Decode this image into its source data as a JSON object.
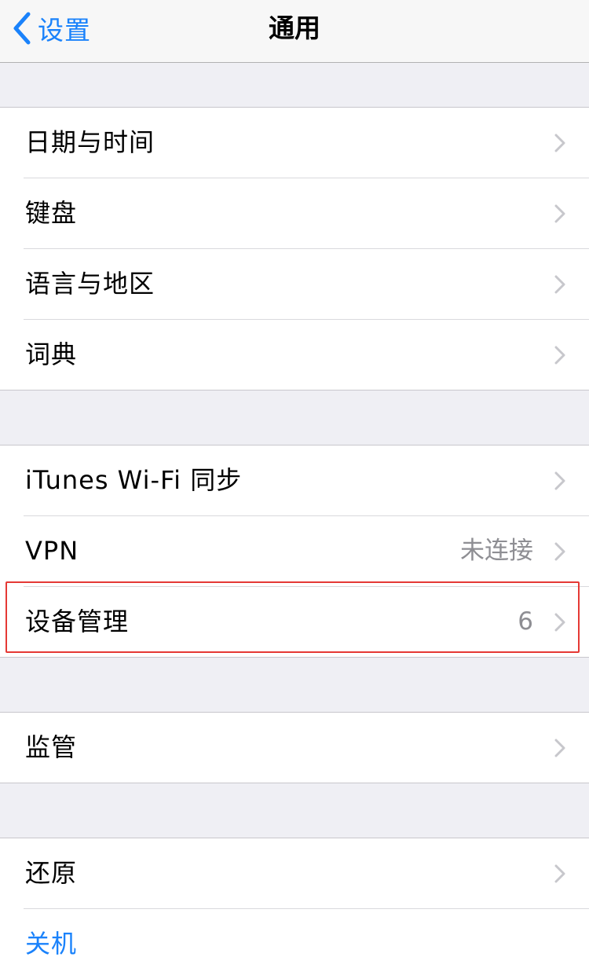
{
  "nav": {
    "back_label": "设置",
    "title": "通用"
  },
  "groups": [
    {
      "rows": [
        {
          "label": "日期与时间"
        },
        {
          "label": "键盘"
        },
        {
          "label": "语言与地区"
        },
        {
          "label": "词典"
        }
      ]
    },
    {
      "rows": [
        {
          "label": "iTunes Wi-Fi 同步"
        },
        {
          "label": "VPN",
          "value": "未连接"
        },
        {
          "label": "设备管理",
          "value": "6"
        }
      ]
    },
    {
      "rows": [
        {
          "label": "监管"
        }
      ]
    },
    {
      "rows": [
        {
          "label": "还原"
        },
        {
          "label": "关机"
        }
      ]
    }
  ],
  "colors": {
    "accent": "#1a82fb",
    "highlight": "#e53935",
    "background": "#efeff4"
  }
}
